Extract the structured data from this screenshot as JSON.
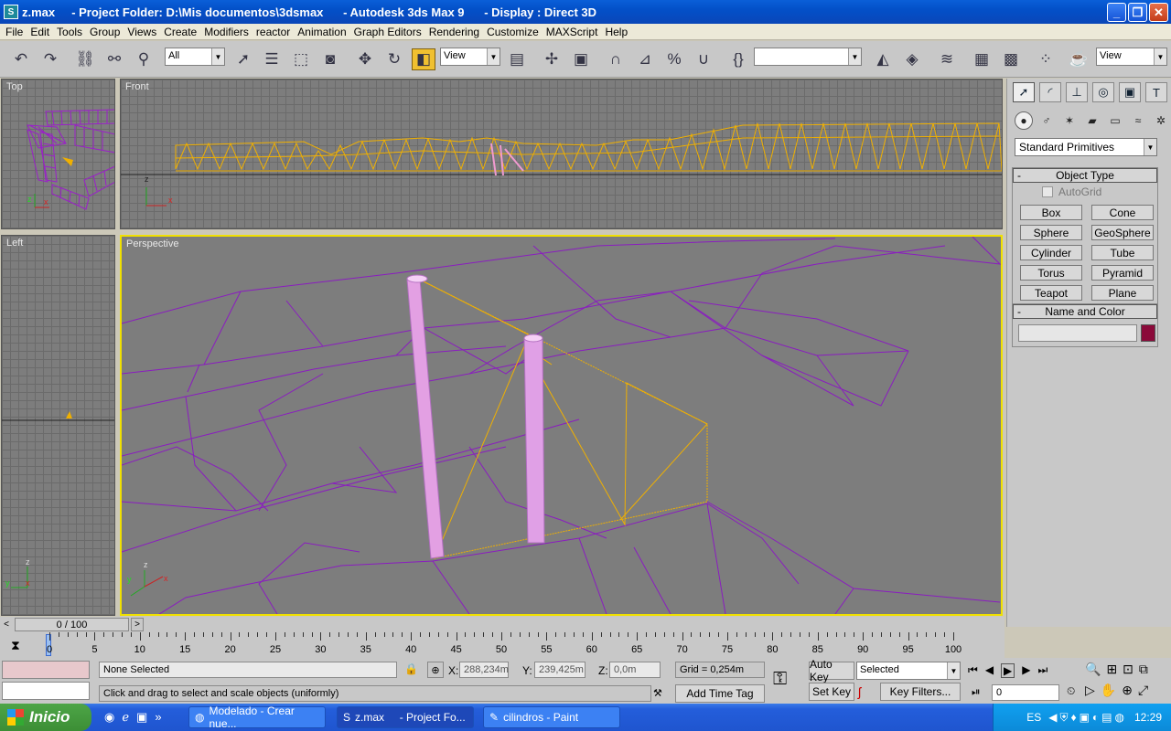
{
  "window": {
    "title": "z.max     - Project Folder: D:\\Mis documentos\\3dsmax      - Autodesk 3ds Max 9      - Display : Direct 3D"
  },
  "menu": [
    "File",
    "Edit",
    "Tools",
    "Group",
    "Views",
    "Create",
    "Modifiers",
    "reactor",
    "Animation",
    "Graph Editors",
    "Rendering",
    "Customize",
    "MAXScript",
    "Help"
  ],
  "toolbar": {
    "selection_filter": "All",
    "ref_coord": "View",
    "named_sel": "",
    "view_combo": "View"
  },
  "viewports": {
    "top": "Top",
    "front": "Front",
    "left": "Left",
    "perspective": "Perspective"
  },
  "command_panel": {
    "category": "Standard Primitives",
    "object_type_title": "Object Type",
    "autogrid": "AutoGrid",
    "primitives": [
      "Box",
      "Cone",
      "Sphere",
      "GeoSphere",
      "Cylinder",
      "Tube",
      "Torus",
      "Pyramid",
      "Teapot",
      "Plane"
    ],
    "name_color_title": "Name and Color",
    "name_value": "",
    "color": "#8b0a3a"
  },
  "timeline": {
    "frame": "0 / 100",
    "ticks": [
      "0",
      "5",
      "10",
      "15",
      "20",
      "25",
      "30",
      "35",
      "40",
      "45",
      "50",
      "55",
      "60",
      "65",
      "70",
      "75",
      "80",
      "85",
      "90",
      "95",
      "100"
    ]
  },
  "status": {
    "selection": "None Selected",
    "prompt": "Click and drag to select and scale objects (uniformly)",
    "x_label": "X:",
    "x": "288,234m",
    "y_label": "Y:",
    "y": "239,425m",
    "z_label": "Z:",
    "z": "0,0m",
    "grid": "Grid = 0,254m",
    "add_time_tag": "Add Time Tag",
    "auto_key": "Auto Key",
    "set_key": "Set Key",
    "key_mode": "Selected",
    "key_filters": "Key Filters...",
    "frame_field": "0"
  },
  "taskbar": {
    "start": "Inicio",
    "tasks": [
      "Modelado - Crear nue...",
      "z.max     - Project Fo...",
      "cilindros - Paint"
    ],
    "lang": "ES",
    "clock": "12:29"
  }
}
